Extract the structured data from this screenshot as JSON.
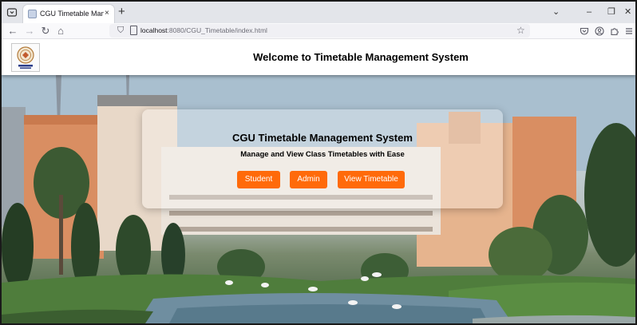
{
  "browser": {
    "tab_title": "CGU Timetable Management Syste",
    "tab_close": "×",
    "new_tab": "+",
    "url_host": "localhost",
    "url_rest": ":8080/CGU_Timetable/index.html",
    "window_controls": {
      "dropdown": "⌄",
      "minimize": "–",
      "maximize": "❐",
      "close": "✕"
    },
    "nav": {
      "back": "←",
      "forward": "→",
      "reload": "↻",
      "home": "⌂"
    },
    "icons": [
      "shield-icon",
      "page-icon",
      "star-icon",
      "pocket-icon",
      "account-icon",
      "extensions-icon",
      "menu-icon"
    ]
  },
  "header": {
    "title": "Welcome to Timetable Management System"
  },
  "hero": {
    "title": "CGU Timetable Management System",
    "subtitle": "Manage and View Class Timetables with Ease",
    "buttons": {
      "student": "Student",
      "admin": "Admin",
      "view_timetable": "View Timetable"
    }
  },
  "colors": {
    "accent": "#ff6a0a",
    "tabstrip": "#e3e5ea",
    "header_bg": "#ffffff"
  }
}
